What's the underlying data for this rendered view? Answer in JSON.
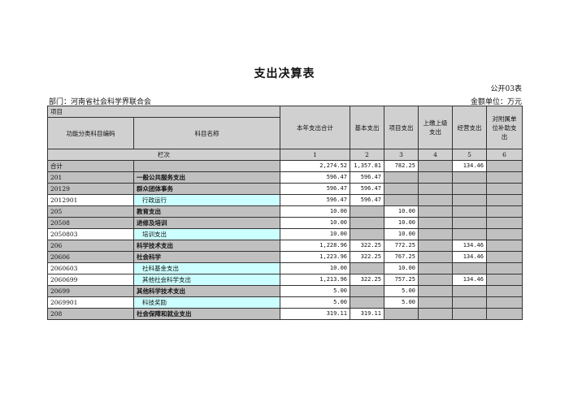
{
  "header": {
    "title": "支出决算表",
    "form_no": "公开03表",
    "department": "部门：河南省社会科学界联合会",
    "unit": "金额单位：万元"
  },
  "columns": {
    "item_group": "项目",
    "code": "功能分类科目编码",
    "name": "科目名称",
    "total": "本年支出合计",
    "basic": "基本支出",
    "project": "项目支出",
    "remit": "上缴上级支出",
    "business": "经营支出",
    "subsidiary": "对附属单位补助支出"
  },
  "index_row": {
    "label": "栏次",
    "nums": [
      "1",
      "2",
      "3",
      "4",
      "5",
      "6"
    ]
  },
  "rows": [
    {
      "code": "合计",
      "name": "",
      "total": "2,274.52",
      "basic": "1,357.81",
      "project": "782.25",
      "remit": "",
      "business": "134.46",
      "subsidiary": "",
      "level": 0
    },
    {
      "code": "201",
      "name": "一般公共服务支出",
      "total": "596.47",
      "basic": "596.47",
      "project": "",
      "remit": "",
      "business": "",
      "subsidiary": "",
      "level": 1
    },
    {
      "code": "20129",
      "name": "群众团体事务",
      "total": "596.47",
      "basic": "596.47",
      "project": "",
      "remit": "",
      "business": "",
      "subsidiary": "",
      "level": 2
    },
    {
      "code": "2012901",
      "name": "行政运行",
      "total": "596.47",
      "basic": "596.47",
      "project": "",
      "remit": "",
      "business": "",
      "subsidiary": "",
      "level": 3
    },
    {
      "code": "205",
      "name": "教育支出",
      "total": "10.00",
      "basic": "",
      "project": "10.00",
      "remit": "",
      "business": "",
      "subsidiary": "",
      "level": 1
    },
    {
      "code": "20508",
      "name": "进修及培训",
      "total": "10.00",
      "basic": "",
      "project": "10.00",
      "remit": "",
      "business": "",
      "subsidiary": "",
      "level": 2
    },
    {
      "code": "2050803",
      "name": "培训支出",
      "total": "10.00",
      "basic": "",
      "project": "10.00",
      "remit": "",
      "business": "",
      "subsidiary": "",
      "level": 3
    },
    {
      "code": "206",
      "name": "科学技术支出",
      "total": "1,228.96",
      "basic": "322.25",
      "project": "772.25",
      "remit": "",
      "business": "134.46",
      "subsidiary": "",
      "level": 1
    },
    {
      "code": "20606",
      "name": "社会科学",
      "total": "1,223.96",
      "basic": "322.25",
      "project": "767.25",
      "remit": "",
      "business": "134.46",
      "subsidiary": "",
      "level": 2
    },
    {
      "code": "2060603",
      "name": "社科基金支出",
      "total": "10.00",
      "basic": "",
      "project": "10.00",
      "remit": "",
      "business": "",
      "subsidiary": "",
      "level": 3
    },
    {
      "code": "2060699",
      "name": "其他社会科学支出",
      "total": "1,213.96",
      "basic": "322.25",
      "project": "757.25",
      "remit": "",
      "business": "134.46",
      "subsidiary": "",
      "level": 3
    },
    {
      "code": "20699",
      "name": "其他科学技术支出",
      "total": "5.00",
      "basic": "",
      "project": "5.00",
      "remit": "",
      "business": "",
      "subsidiary": "",
      "level": 2
    },
    {
      "code": "2069901",
      "name": "科技奖励",
      "total": "5.00",
      "basic": "",
      "project": "5.00",
      "remit": "",
      "business": "",
      "subsidiary": "",
      "level": 3
    },
    {
      "code": "208",
      "name": "社会保障和就业支出",
      "total": "319.11",
      "basic": "319.11",
      "project": "",
      "remit": "",
      "business": "",
      "subsidiary": "",
      "level": 1
    }
  ]
}
